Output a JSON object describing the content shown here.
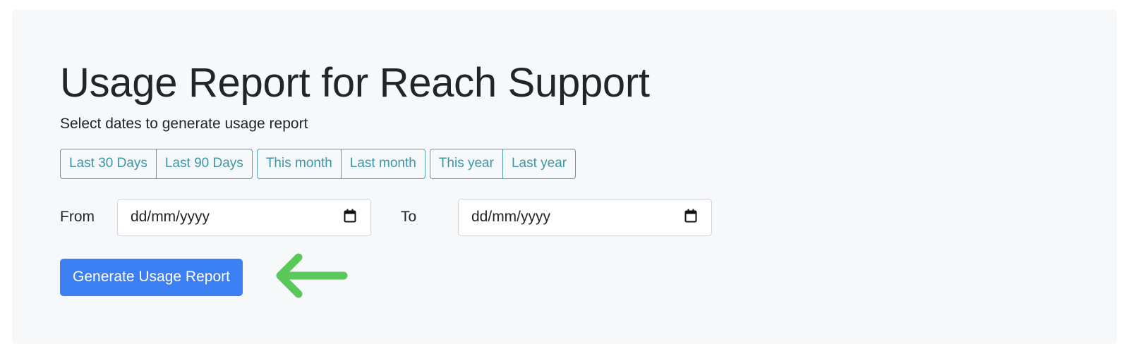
{
  "page": {
    "title": "Usage Report for Reach Support",
    "subtitle": "Select dates to generate usage report"
  },
  "quick_ranges": {
    "group1": [
      "Last 30 Days",
      "Last 90 Days"
    ],
    "group2": [
      "This month",
      "Last month"
    ],
    "group3": [
      "This year",
      "Last year"
    ]
  },
  "date_range": {
    "from_label": "From",
    "from_value": "dd/mm/yyyy",
    "to_label": "To",
    "to_value": "dd/mm/yyyy"
  },
  "actions": {
    "generate_label": "Generate Usage Report"
  },
  "icons": {
    "calendar": "calendar-icon",
    "annotation_arrow": "left-arrow-icon"
  },
  "colors": {
    "panel_bg": "#f7f8fa",
    "outline_accent": "#3a97a8",
    "primary": "#3b7ff2",
    "arrow": "#5ac85a"
  }
}
